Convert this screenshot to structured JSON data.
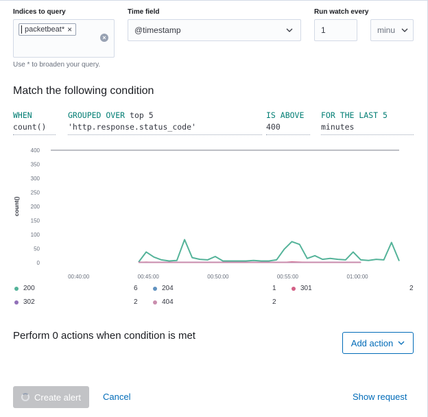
{
  "form": {
    "indices_label": "Indices to query",
    "index_pill": "packetbeat*",
    "pill_remove": "×",
    "clear_icon": "×",
    "helper_text": "Use * to broaden your query.",
    "time_field_label": "Time field",
    "time_field_value": "@timestamp",
    "run_every_label": "Run watch every",
    "run_every_value": "1",
    "run_every_unit": "minu"
  },
  "condition": {
    "title": "Match the following condition",
    "when_label": "WHEN",
    "when_value": "count()",
    "grouped_label": "GROUPED OVER",
    "grouped_top": "top 5",
    "grouped_field": "'http.response.status_code'",
    "above_label": "IS ABOVE",
    "above_value": "400",
    "last_label": "FOR THE LAST 5",
    "last_value": "minutes"
  },
  "chart_data": {
    "type": "line",
    "ylabel": "count()",
    "ylim": [
      0,
      400
    ],
    "yticks": [
      "400",
      "350",
      "300",
      "250",
      "200",
      "150",
      "100",
      "50",
      "0"
    ],
    "xticks": [
      "00:40:00",
      "00:45:00",
      "00:50:00",
      "00:55:00",
      "01:00:00"
    ],
    "threshold": 400,
    "x_minutes": [
      0,
      0.5,
      1,
      1.5,
      2,
      2.5,
      3,
      3.5,
      4,
      4.5,
      5,
      5.5,
      6,
      6.5,
      7,
      7.5,
      8,
      8.5,
      9,
      9.5,
      10,
      10.5,
      11,
      11.5,
      12,
      12.5,
      13,
      13.5,
      14,
      14.5,
      15,
      15.5,
      16,
      16.5,
      17,
      17.5
    ],
    "series": [
      {
        "name": "200",
        "color": "#54b399",
        "values": [
          2,
          38,
          20,
          10,
          6,
          8,
          82,
          18,
          12,
          10,
          22,
          6,
          6,
          6,
          6,
          8,
          6,
          6,
          10,
          48,
          75,
          65,
          15,
          25,
          12,
          15,
          12,
          10,
          38,
          10,
          8,
          12,
          10,
          72,
          6
        ]
      },
      {
        "name": "204",
        "color": "#6092c0",
        "values": [
          2,
          1,
          1,
          1,
          1,
          1,
          1,
          1,
          1,
          1,
          1,
          1,
          1,
          1,
          1,
          1,
          1,
          1,
          1,
          1,
          1,
          1,
          1,
          1,
          1,
          1,
          1,
          1,
          1,
          1
        ]
      },
      {
        "name": "302",
        "color": "#9170b8",
        "values": [
          1,
          1,
          1,
          1,
          1,
          1,
          1,
          1,
          1,
          1,
          1,
          1,
          1,
          1,
          1,
          1,
          1,
          1,
          1,
          1,
          1,
          1,
          1,
          1,
          1,
          1,
          1,
          1,
          1,
          1
        ]
      },
      {
        "name": "301",
        "color": "#d36086",
        "values": [
          1,
          2,
          1,
          1,
          1,
          1,
          1,
          1,
          1,
          1,
          1,
          1,
          1,
          1,
          1,
          1,
          1,
          1,
          1,
          1,
          3,
          2,
          1,
          1,
          1,
          1,
          1,
          1,
          1,
          1
        ]
      },
      {
        "name": "404",
        "color": "#ca8eae",
        "values": [
          1,
          1,
          1,
          1,
          1,
          1,
          1,
          1,
          1,
          1,
          1,
          1,
          1,
          1,
          1,
          1,
          1,
          1,
          1,
          1,
          1,
          1,
          1,
          1,
          1,
          1,
          1,
          1,
          1,
          1
        ]
      }
    ],
    "legend": [
      {
        "name": "200",
        "value": "6",
        "color": "#54b399"
      },
      {
        "name": "204",
        "value": "1",
        "color": "#6092c0"
      },
      {
        "name": "301",
        "value": "2",
        "color": "#d36086"
      },
      {
        "name": "302",
        "value": "2",
        "color": "#9170b8"
      },
      {
        "name": "404",
        "value": "2",
        "color": "#ca8eae"
      }
    ],
    "threshold_color": "#a5a9b0",
    "grid": false
  },
  "actions": {
    "summary": "Perform 0 actions when condition is met",
    "add_action": "Add action"
  },
  "footer": {
    "create_alert": "Create alert",
    "cancel": "Cancel",
    "show_request": "Show request"
  }
}
